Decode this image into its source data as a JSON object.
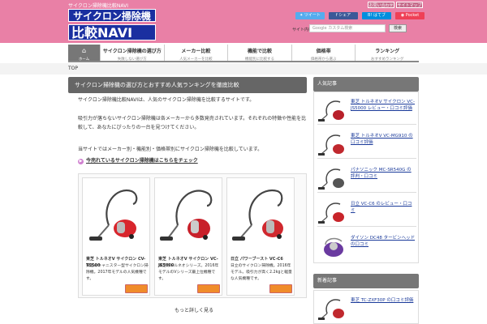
{
  "header": {
    "tagline": "サイクロン掃除機比較NAVI",
    "logo_line1": "サイクロン掃除機",
    "logo_line2": "比較NAVI",
    "toplinks": [
      "お問い合わせ",
      "サイトマップ"
    ],
    "social": [
      "ツイート",
      "シェア",
      "はてブ",
      "Pocket"
    ],
    "search_label": "サイト内検索",
    "search_placeholder": "Google カスタム検索",
    "search_button": "検索"
  },
  "nav": {
    "home": {
      "label": "",
      "sub": "ホーム"
    },
    "items": [
      {
        "label": "サイクロン掃除機の選び方",
        "sub": "失敗しない選び方"
      },
      {
        "label": "メーカー比較",
        "sub": "人気メーカーを比較"
      },
      {
        "label": "機能で比較",
        "sub": "機能別に比較する"
      },
      {
        "label": "価格帯",
        "sub": "価格帯から選ぶ"
      },
      {
        "label": "ランキング",
        "sub": "おすすめランキング"
      }
    ]
  },
  "breadcrumb": "TOP",
  "main": {
    "title": "サイクロン掃除機の選び方とおすすめ人気ランキングを徹底比較",
    "p1": "サイクロン掃除機比較NAVIは、人気のサイクロン掃除機を比較するサイトです。",
    "p2": "吸引力が落ちないサイクロン掃除機は各メーカーから多数発売されています。それぞれの特徴や性能を比較して、あなたにぴったりの一台を見つけてください。",
    "p3": "当サイトではメーカー別・機能別・価格帯別にサイクロン掃除機を比較しています。",
    "cta": "今売れているサイクロン掃除機はこちらをチェック",
    "cta_icon": "▶",
    "more": "もっと詳しく見る"
  },
  "products": [
    {
      "name": "東芝 トルネオV サイクロン CV-TS500",
      "desc": "東芝のキャニスター型サイクロン掃除機。2017年モデルの人気機種です。",
      "color": "#d8252c"
    },
    {
      "name": "東芝 トルネオV サイクロン VC-JS5000",
      "desc": "東芝のトルネオシリーズ。2016年モデルのVシリーズ最上位機種です。",
      "color": "#c8202a"
    },
    {
      "name": "日立 パワーブースト VC-C6",
      "desc": "日立のサイクロン掃除機。2016年モデル。吸引力が高く2.2kgと軽量な人気機種です。",
      "color": "#d0282e"
    }
  ],
  "sidebar": {
    "heading1": "人気記事",
    "items": [
      {
        "label": "東芝 トルネオV サイクロン VC-JS5000 レビュー・口コミ評価",
        "color": "#b8202a"
      },
      {
        "label": "東芝 トルネオV VC-MG910 の口コミ評価",
        "color": "#c0282e"
      },
      {
        "label": "パナソニック MC-SR540G の評判・口コミ",
        "color": "#555555"
      },
      {
        "label": "日立 VC-C6 のレビュー・口コミ",
        "color": "#c8242a"
      },
      {
        "label": "ダイソン DC48 タービンヘッドの口コミ",
        "color": "#6a3aa0"
      }
    ],
    "heading2": "新着記事",
    "new_items": [
      {
        "label": "東芝 TC-ZXF30P の口コミ評価",
        "color": "#c0282e"
      }
    ]
  }
}
